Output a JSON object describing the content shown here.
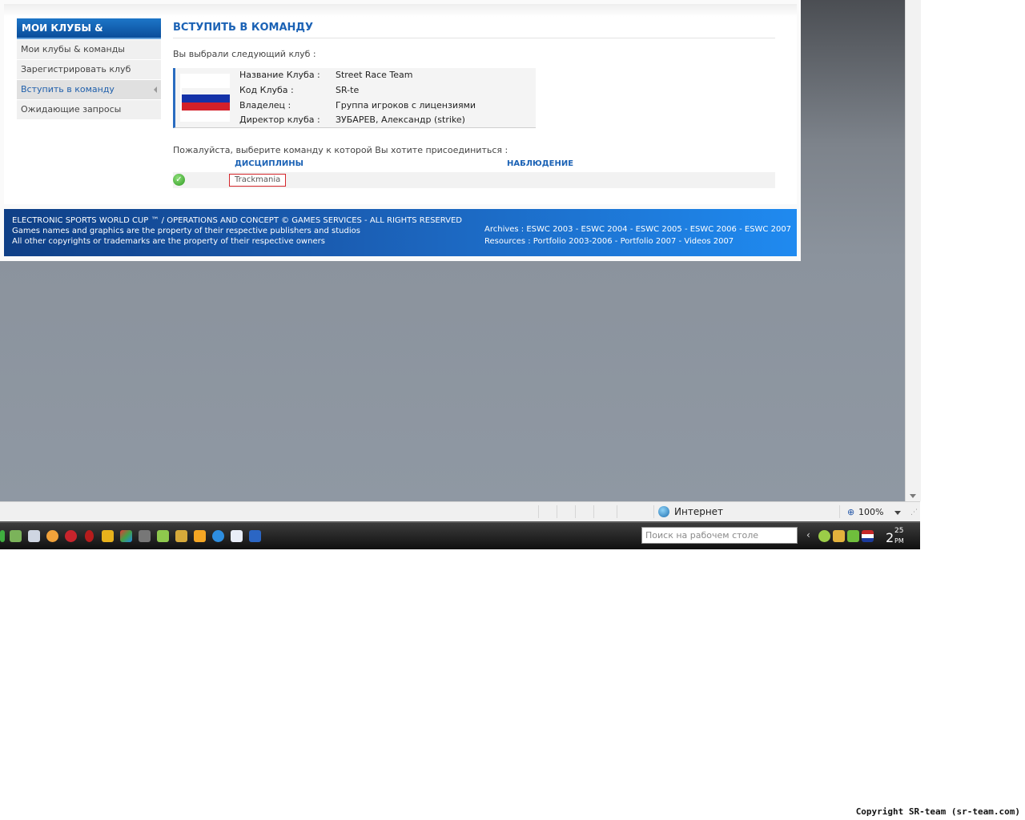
{
  "sidebar": {
    "title": "МОИ КЛУБЫ & КОМАНДЫ",
    "items": [
      {
        "label": "Мои клубы & команды"
      },
      {
        "label": "Зарегистрировать клуб"
      },
      {
        "label": "Вступить в команду",
        "active": true
      },
      {
        "label": "Ожидающие запросы"
      }
    ]
  },
  "main": {
    "title": "ВСТУПИТЬ В КОМАНДУ",
    "selected_label": "Вы выбрали следующий клуб :",
    "club": {
      "name_label": "Название Клуба :",
      "name": "Street Race Team",
      "code_label": "Код Клуба :",
      "code": "SR-te",
      "owner_label": "Владелец :",
      "owner": "Группа игроков с лицензиями",
      "director_label": "Директор клуба :",
      "director": "ЗУБАРЕВ, Александр (strike)"
    },
    "choose_label": "Пожалуйста, выберите команду к которой Вы хотите присоединиться :",
    "columns": {
      "disciplines": "ДИСЦИПЛИНЫ",
      "observation": "НАБЛЮДЕНИЕ"
    },
    "teams": [
      {
        "name": "Trackmania",
        "icon": "check-icon"
      }
    ]
  },
  "footer": {
    "line1": "ELECTRONIC SPORTS WORLD CUP ™ / OPERATIONS AND CONCEPT © GAMES SERVICES - ALL RIGHTS RESERVED",
    "line2": "Games names and graphics are the property of their respective publishers and studios",
    "line3": "All other copyrights or trademarks are the property of their respective owners",
    "archives": "Archives : ESWC 2003 - ESWC 2004 - ESWC 2005 - ESWC 2006 - ESWC 2007",
    "resources": "Resources : Portfolio 2003-2006 - Portfolio 2007 - Videos 2007"
  },
  "statusbar": {
    "zone": "Интернет",
    "zoom": "100%"
  },
  "taskbar": {
    "search_placeholder": "Поиск на рабочем столе",
    "clock_hour": "2",
    "clock_min": "25",
    "clock_ampm": "PM"
  },
  "watermark": "Copyright SR-team (sr-team.com)",
  "colors": {
    "accent": "#1b62b5",
    "footer_blue": "#1f8af0",
    "highlight_border": "#d4262b"
  }
}
